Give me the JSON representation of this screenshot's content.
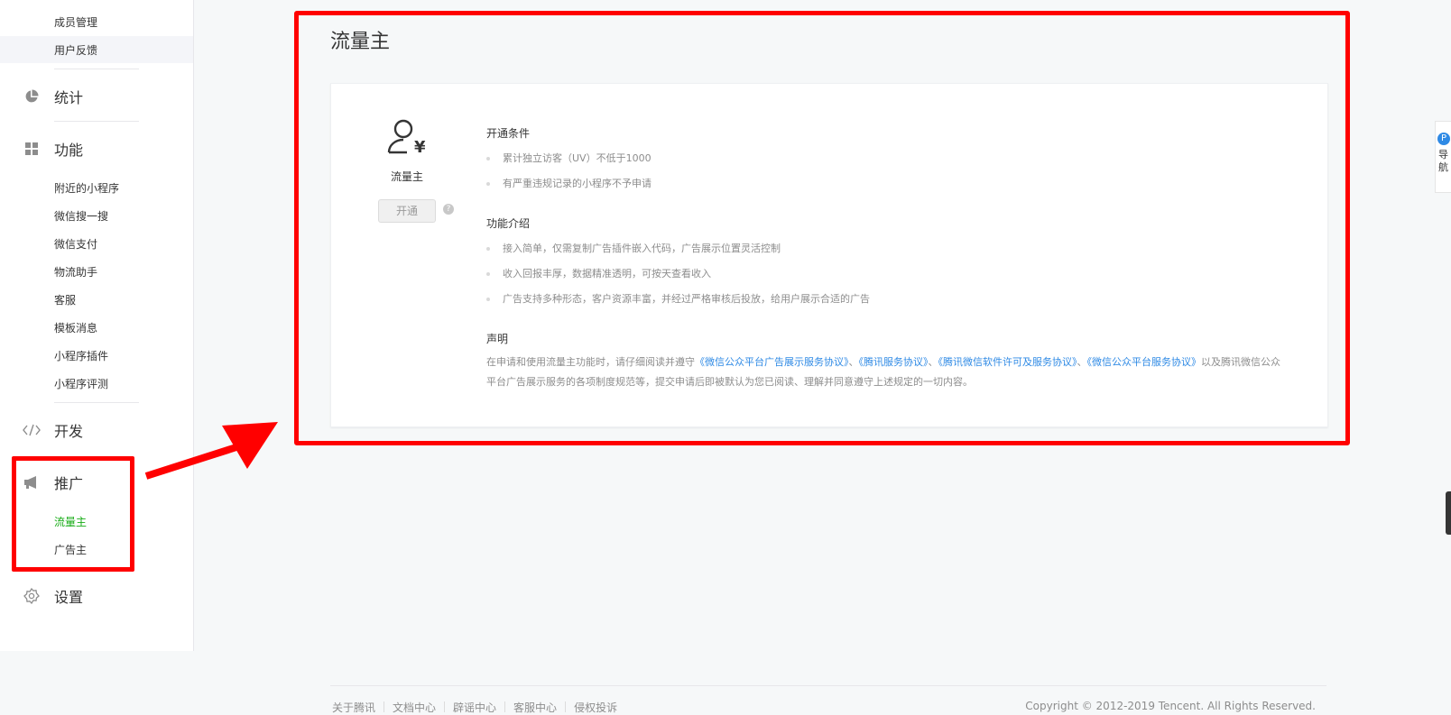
{
  "sidebar": {
    "top_items": [
      {
        "label": "成员管理"
      },
      {
        "label": "用户反馈"
      }
    ],
    "stats": {
      "label": "统计",
      "icon": "pie-chart-icon"
    },
    "features": {
      "label": "功能",
      "icon": "grid-icon",
      "items": [
        {
          "label": "附近的小程序"
        },
        {
          "label": "微信搜一搜"
        },
        {
          "label": "微信支付"
        },
        {
          "label": "物流助手"
        },
        {
          "label": "客服"
        },
        {
          "label": "模板消息"
        },
        {
          "label": "小程序插件"
        },
        {
          "label": "小程序评测"
        }
      ]
    },
    "dev": {
      "label": "开发",
      "icon": "code-icon"
    },
    "promo": {
      "label": "推广",
      "icon": "megaphone-icon",
      "items": [
        {
          "label": "流量主",
          "active": true
        },
        {
          "label": "广告主"
        }
      ]
    },
    "settings": {
      "label": "设置",
      "icon": "gear-icon"
    }
  },
  "main": {
    "title": "流量主",
    "card": {
      "icon": "user-yuan-icon",
      "name": "流量主",
      "open_button": "开通",
      "help_icon": "question-icon",
      "conditions_title": "开通条件",
      "conditions": [
        "累计独立访客（UV）不低于1000",
        "有严重违规记录的小程序不予申请"
      ],
      "features_title": "功能介绍",
      "features": [
        "接入简单，仅需复制广告插件嵌入代码，广告展示位置灵活控制",
        "收入回报丰厚，数据精准透明，可按天查看收入",
        "广告支持多种形态，客户资源丰富，并经过严格审核后投放，给用户展示合适的广告"
      ],
      "statement_title": "声明",
      "statement_prefix": "在申请和使用流量主功能时，请仔细阅读并遵守",
      "statement_links": [
        "《微信公众平台广告展示服务协议》",
        "《腾讯服务协议》",
        "《腾讯微信软件许可及服务协议》",
        "《微信公众平台服务协议》"
      ],
      "statement_sep": "、",
      "statement_suffix": "以及腾讯微信公众平台广告展示服务的各项制度规范等，提交申请后即被默认为您已阅读、理解并同意遵守上述规定的一切内容。"
    }
  },
  "side_tab": {
    "badge": "P",
    "label": "导航"
  },
  "footer": {
    "links": [
      "关于腾讯",
      "文档中心",
      "辟谣中心",
      "客服中心",
      "侵权投诉"
    ],
    "copyright": "Copyright © 2012-2019 Tencent. All Rights Reserved."
  },
  "colors": {
    "accent_green": "#1aad19",
    "link_blue": "#2f8ae5",
    "annotation_red": "#ff0000"
  }
}
